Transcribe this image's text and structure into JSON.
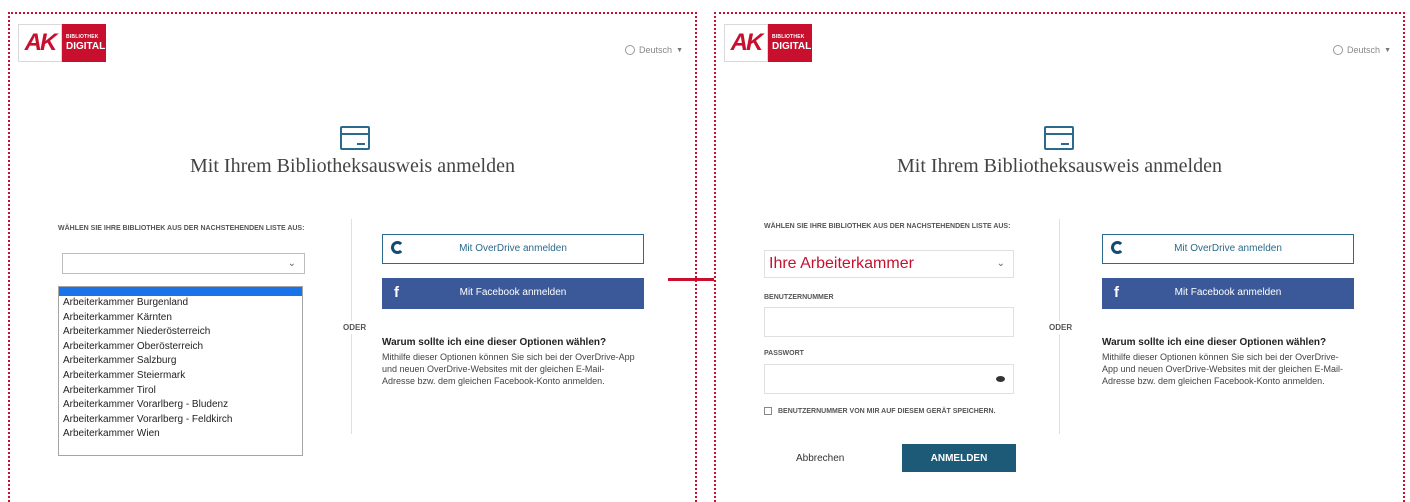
{
  "brand": {
    "logo_mark": "AK",
    "logo_small": "BIBLIOTHEK",
    "logo_big": "DIGITAL",
    "accent": "#c8102e"
  },
  "language": {
    "label": "Deutsch",
    "icon": "globe-icon"
  },
  "title": "Mit Ihrem Bibliotheksausweis anmelden",
  "library_label": "WÄHLEN SIE IHRE BIBLIOTHEK AUS DER NACHSTEHENDEN LISTE AUS:",
  "library_options": [
    "Arbeiterkammer Burgenland",
    "Arbeiterkammer Kärnten",
    "Arbeiterkammer Niederösterreich",
    "Arbeiterkammer Oberösterreich",
    "Arbeiterkammer Salzburg",
    "Arbeiterkammer Steiermark",
    "Arbeiterkammer Tirol",
    "Arbeiterkammer Vorarlberg - Bludenz",
    "Arbeiterkammer Vorarlberg - Feldkirch",
    "Arbeiterkammer Wien"
  ],
  "left_selected": "",
  "right_selected": "Ihre Arbeiterkammer",
  "or_label": "ODER",
  "overdrive_button": "Mit OverDrive anmelden",
  "facebook_button": "Mit Facebook anmelden",
  "facebook_glyph": "f",
  "why_title": "Warum sollte ich eine dieser Optionen wählen?",
  "why_text": "Mithilfe dieser Optionen können Sie sich bei der OverDrive-App und neuen OverDrive-Websites mit der gleichen E-Mail-Adresse bzw. dem gleichen Facebook-Konto anmelden.",
  "user_number_label": "BENUTZERNUMMER",
  "password_label": "PASSWORT",
  "remember_label": "BENUTZERNUMMER VON MIR AUF DIESEM GERÄT SPEICHERN.",
  "cancel_label": "Abbrechen",
  "submit_label": "ANMELDEN",
  "colors": {
    "accent": "#c8102e",
    "primary": "#1d5a78",
    "facebook": "#3b5998",
    "highlight": "#1a73e8"
  }
}
